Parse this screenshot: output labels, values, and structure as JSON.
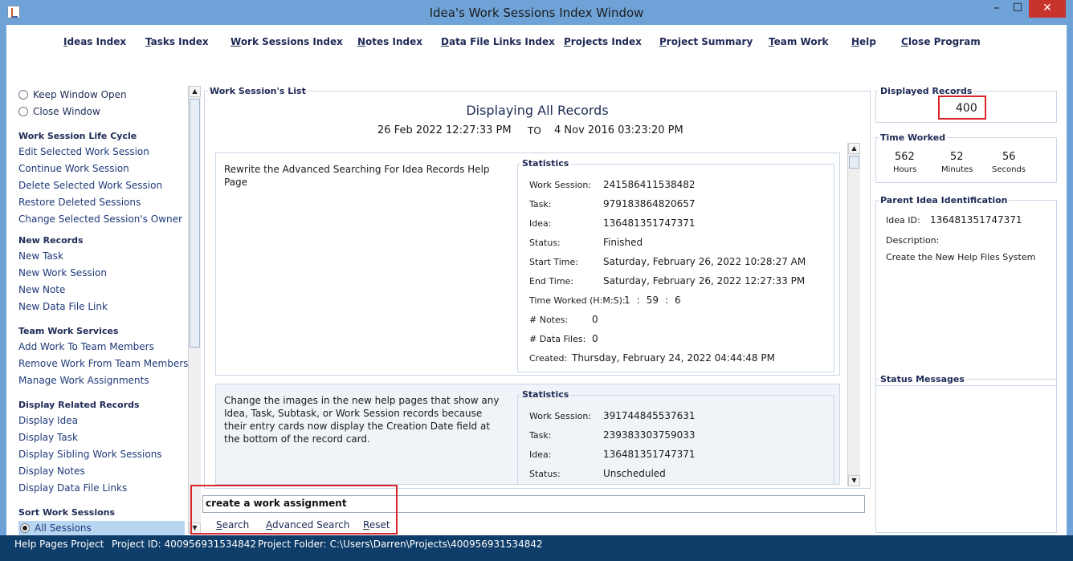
{
  "window": {
    "title": "Idea's Work Sessions Index Window",
    "minimize": "–",
    "maximize": "☐",
    "close": "✕"
  },
  "menu": [
    "Ideas Index",
    "Tasks Index",
    "Work Sessions Index",
    "Notes Index",
    "Data File Links Index",
    "Projects Index",
    "Project Summary",
    "Team Work",
    "Help",
    "Close Program"
  ],
  "left": {
    "radio_keep": "Keep Window Open",
    "radio_close": "Close Window",
    "life_cycle": {
      "title": "Work Session Life Cycle",
      "items": [
        "Edit Selected Work Session",
        "Continue Work Session",
        "Delete Selected Work Session",
        "Restore Deleted Sessions",
        "Change Selected Session's Owner"
      ]
    },
    "new_records": {
      "title": "New Records",
      "items": [
        "New Task",
        "New Work Session",
        "New Note",
        "New Data File Link"
      ]
    },
    "team_work": {
      "title": "Team Work Services",
      "items": [
        "Add Work To Team Members",
        "Remove Work From Team Members",
        "Manage Work Assignments"
      ]
    },
    "related": {
      "title": "Display Related Records",
      "items": [
        "Display Idea",
        "Display Task",
        "Display Sibling Work Sessions",
        "Display Notes",
        "Display Data File Links"
      ]
    },
    "sort": {
      "title": "Sort Work Sessions",
      "selected": "All Sessions"
    }
  },
  "center": {
    "legend": "Work Session's List",
    "title": "Displaying All Records",
    "date_from": "26 Feb 2022  12:27:33 PM",
    "to": "TO",
    "date_to": "4 Nov 2016  03:23:20 PM",
    "cards": [
      {
        "description": "Rewrite the Advanced Searching For Idea Records Help Page",
        "stats_legend": "Statistics",
        "work_session_label": "Work Session:",
        "work_session": "241586411538482",
        "task_label": "Task:",
        "task": "979183864820657",
        "idea_label": "Idea:",
        "idea": "136481351747371",
        "status_label": "Status:",
        "status": "Finished",
        "start_label": "Start Time:",
        "start": "Saturday, February 26, 2022   10:28:27 AM",
        "end_label": "End Time:",
        "end": "Saturday, February 26, 2022   12:27:33 PM",
        "worked_label": "Time Worked (H:M:S):",
        "worked_h": "1",
        "worked_m": "59",
        "worked_s": "6",
        "colon": ":",
        "notes_label": "# Notes:",
        "notes": "0",
        "files_label": "# Data Files:",
        "files": "0",
        "created_label": "Created:",
        "created": "Thursday, February 24, 2022   04:44:48 PM"
      },
      {
        "description": "Change the images in the new help pages that show any Idea, Task, Subtask, or Work Session records because their entry cards now display the Creation Date field at the bottom of the record card.",
        "stats_legend": "Statistics",
        "work_session_label": "Work Session:",
        "work_session": "391744845537631",
        "task_label": "Task:",
        "task": "239383303759033",
        "idea_label": "Idea:",
        "idea": "136481351747371",
        "status_label": "Status:",
        "status": "Unscheduled"
      }
    ],
    "search_value": "create a work assignment",
    "search_btn": "Search",
    "advanced_btn": "Advanced Search",
    "reset_btn": "Reset"
  },
  "right": {
    "displayed_legend": "Displayed Records",
    "displayed": "400",
    "time_legend": "Time Worked",
    "hours": "562",
    "hours_label": "Hours",
    "minutes": "52",
    "minutes_label": "Minutes",
    "seconds": "56",
    "seconds_label": "Seconds",
    "parent_legend": "Parent Idea Identification",
    "idea_id_label": "Idea ID:",
    "idea_id": "136481351747371",
    "desc_label": "Description:",
    "desc": "Create the New Help Files System",
    "status_legend": "Status Messages"
  },
  "statusbar": {
    "project": "Help Pages Project",
    "project_id": "Project ID:  400956931534842",
    "folder": "Project Folder:  C:\\Users\\Darren\\Projects\\400956931534842"
  },
  "colors": {
    "titlebar": "#6fa3d8",
    "statusbar": "#0e3d69",
    "highlight": "#d9242a",
    "selection": "#b8d6f2"
  }
}
